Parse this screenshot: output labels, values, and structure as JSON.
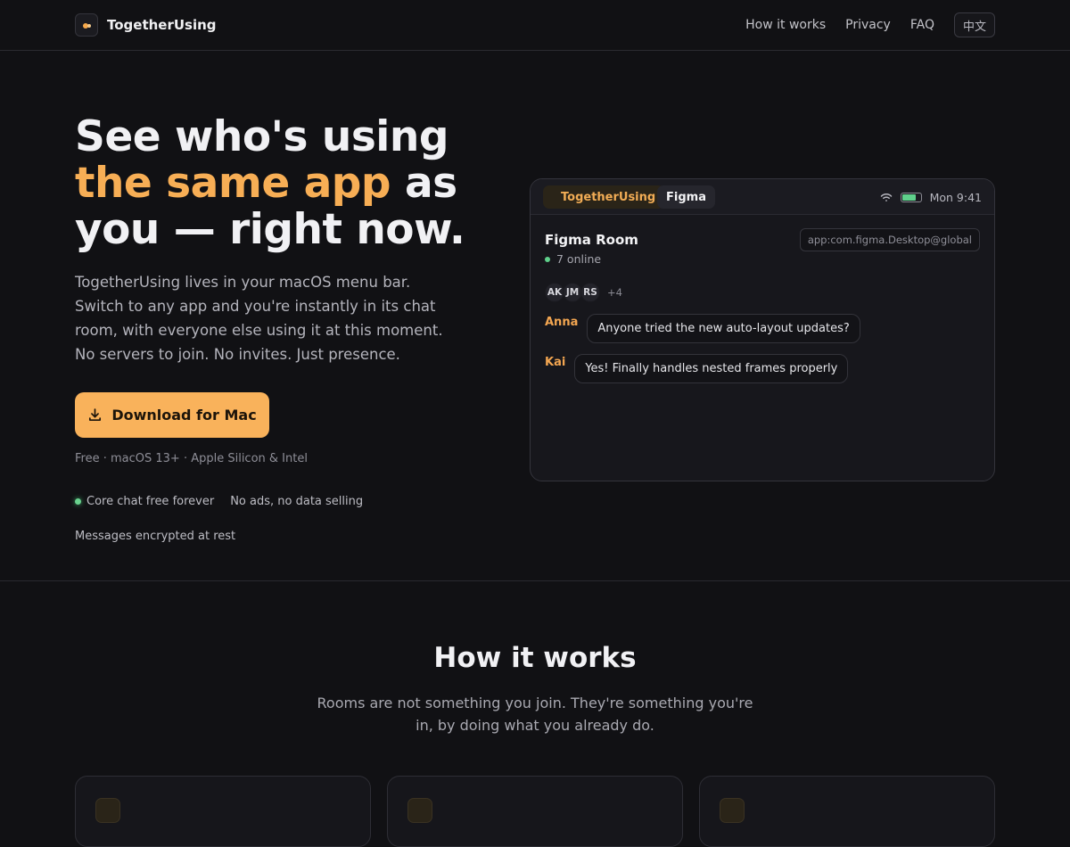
{
  "header": {
    "brand_name": "TogetherUsing",
    "nav": {
      "how_it_works": "How it works",
      "privacy": "Privacy",
      "faq": "FAQ",
      "language": "中文"
    }
  },
  "hero": {
    "title_part1": "See who's using ",
    "title_accent": "the same app",
    "title_part2": " as you — right now.",
    "description": "TogetherUsing lives in your macOS menu bar. Switch to any app and you're instantly in its chat room, with everyone else using it at this moment. No servers to join. No invites. Just presence.",
    "download_label": "Download for Mac",
    "meta": "Free · macOS 13+ · Apple Silicon & Intel",
    "features": [
      "Core chat free forever",
      "No ads, no data selling",
      "Messages encrypted at rest"
    ]
  },
  "mock": {
    "app_pill": "TogetherUsing",
    "room_pill": "Figma",
    "clock": "Mon 9:41",
    "battery_level": 0.75,
    "room_title": "Figma Room",
    "online": "7 online",
    "room_id": "app:com.figma.Desktop@global",
    "avatars": [
      "AK",
      "JM",
      "RS"
    ],
    "more": "+4",
    "messages": [
      {
        "name": "Anna",
        "text": "Anyone tried the new auto-layout updates?"
      },
      {
        "name": "Kai",
        "text": "Yes! Finally handles nested frames properly"
      }
    ],
    "colors": {
      "accent": "#f7ae55",
      "online": "#5fd08b"
    }
  },
  "how": {
    "title": "How it works",
    "subtitle": "Rooms are not something you join. They're something you're in, by doing what you already do."
  }
}
